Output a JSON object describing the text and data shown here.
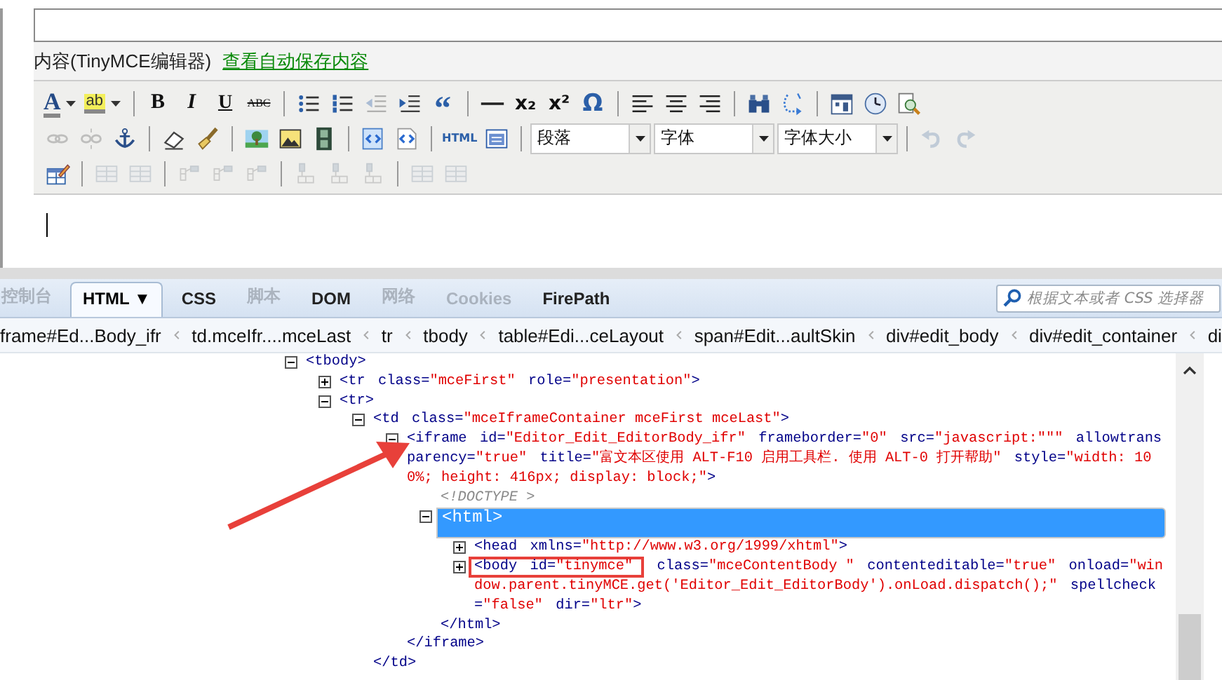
{
  "editor": {
    "label": "内容(TinyMCE编辑器)",
    "autosave_link": "查看自动保存内容",
    "toolbar": {
      "rows": [
        {
          "items": [
            {
              "kind": "fontcolor",
              "glyph": "A",
              "disabled": false
            },
            {
              "kind": "highlight",
              "glyph": "ab",
              "disabled": false
            },
            {
              "kind": "sep"
            },
            {
              "kind": "bold",
              "glyph": "B",
              "disabled": false
            },
            {
              "kind": "italic",
              "glyph": "I",
              "disabled": false
            },
            {
              "kind": "underline",
              "glyph": "U",
              "disabled": false
            },
            {
              "kind": "strike",
              "glyph": "ABC",
              "disabled": false
            },
            {
              "kind": "sep"
            },
            {
              "kind": "bullets",
              "disabled": false
            },
            {
              "kind": "numbers",
              "disabled": false
            },
            {
              "kind": "outdent",
              "disabled": true
            },
            {
              "kind": "indent",
              "disabled": false
            },
            {
              "kind": "quote",
              "glyph": "“",
              "disabled": false
            },
            {
              "kind": "sep"
            },
            {
              "kind": "rule",
              "disabled": false
            },
            {
              "kind": "glyph",
              "glyph": "x₂",
              "disabled": false
            },
            {
              "kind": "glyph",
              "glyph": "x²",
              "disabled": false
            },
            {
              "kind": "symbol",
              "glyph": "Ω",
              "disabled": false
            },
            {
              "kind": "sep"
            },
            {
              "kind": "align-left",
              "disabled": false
            },
            {
              "kind": "align-center",
              "disabled": false
            },
            {
              "kind": "align-right",
              "disabled": false
            },
            {
              "kind": "sep"
            },
            {
              "kind": "binoculars",
              "disabled": false
            },
            {
              "kind": "replace",
              "disabled": false
            },
            {
              "kind": "sep"
            },
            {
              "kind": "calendar",
              "disabled": false
            },
            {
              "kind": "clock",
              "disabled": false
            },
            {
              "kind": "preview",
              "disabled": false
            }
          ]
        },
        {
          "items": [
            {
              "kind": "link",
              "disabled": true
            },
            {
              "kind": "unlink",
              "disabled": true
            },
            {
              "kind": "anchor",
              "disabled": false
            },
            {
              "kind": "sep"
            },
            {
              "kind": "eraser",
              "disabled": false
            },
            {
              "kind": "brush",
              "disabled": false
            },
            {
              "kind": "sep"
            },
            {
              "kind": "picture",
              "disabled": false
            },
            {
              "kind": "image",
              "disabled": false
            },
            {
              "kind": "film",
              "disabled": false
            },
            {
              "kind": "sep"
            },
            {
              "kind": "template",
              "disabled": false
            },
            {
              "kind": "code",
              "disabled": false
            },
            {
              "kind": "sep"
            },
            {
              "kind": "small",
              "glyph": "HTML",
              "disabled": false
            },
            {
              "kind": "window",
              "disabled": false
            },
            {
              "kind": "sep"
            },
            {
              "kind": "select",
              "value": "段落"
            },
            {
              "kind": "select",
              "value": "字体"
            },
            {
              "kind": "select",
              "value": "字体大小"
            },
            {
              "kind": "sep"
            },
            {
              "kind": "undo",
              "disabled": true
            },
            {
              "kind": "redo",
              "disabled": true
            }
          ]
        },
        {
          "items": [
            {
              "kind": "pencil-table",
              "disabled": false
            },
            {
              "kind": "sep"
            },
            {
              "kind": "grid",
              "disabled": true
            },
            {
              "kind": "grid",
              "disabled": true
            },
            {
              "kind": "sep"
            },
            {
              "kind": "rowop",
              "disabled": true
            },
            {
              "kind": "rowop",
              "disabled": true
            },
            {
              "kind": "rowop",
              "disabled": true
            },
            {
              "kind": "sep"
            },
            {
              "kind": "colop",
              "disabled": true
            },
            {
              "kind": "colop",
              "disabled": true
            },
            {
              "kind": "colop",
              "disabled": true
            },
            {
              "kind": "sep"
            },
            {
              "kind": "grid",
              "disabled": true
            },
            {
              "kind": "grid",
              "disabled": true
            }
          ]
        }
      ]
    }
  },
  "devtools": {
    "tabs": [
      {
        "label": "控制台",
        "selected": false,
        "disabled": true
      },
      {
        "label": "HTML ▼",
        "selected": true,
        "disabled": false
      },
      {
        "label": "CSS",
        "selected": false,
        "disabled": false
      },
      {
        "label": "脚本",
        "selected": false,
        "disabled": true
      },
      {
        "label": "DOM",
        "selected": false,
        "disabled": false
      },
      {
        "label": "网络",
        "selected": false,
        "disabled": true
      },
      {
        "label": "Cookies",
        "selected": false,
        "disabled": true
      },
      {
        "label": "FirePath",
        "selected": false,
        "disabled": false
      }
    ],
    "search": {
      "placeholder": "根据文本或者 CSS 选择器"
    },
    "breadcrumbs": [
      "frame#Ed...Body_ifr",
      "td.mceIfr....mceLast",
      "tr",
      "tbody",
      "table#Edi...ceLayout",
      "span#Edit...aultSkin",
      "div#edit_body",
      "div#edit_container",
      "di"
    ],
    "tree": [
      {
        "kind": "element",
        "tag": "<tbody",
        "end": ">",
        "expanded": true,
        "selected": false,
        "boxed": false,
        "children": [
          {
            "kind": "element",
            "tag": "<tr",
            "attrs": [
              {
                "name": "class=",
                "value": "\"mceFirst\""
              },
              {
                "name": "role=",
                "value": "\"presentation\""
              }
            ],
            "end": ">",
            "expanded": false,
            "selected": false,
            "boxed": false
          },
          {
            "kind": "element",
            "tag": "<tr",
            "end": ">",
            "expanded": true,
            "selected": false,
            "boxed": false,
            "children": [
              {
                "kind": "element",
                "tag": "<td",
                "attrs": [
                  {
                    "name": "class=",
                    "value": "\"mceIframeContainer mceFirst mceLast\""
                  }
                ],
                "end": ">",
                "expanded": true,
                "selected": false,
                "boxed": false,
                "closing": "</td>",
                "children": [
                  {
                    "kind": "element",
                    "tag": "<iframe",
                    "attrs": [
                      {
                        "name": "id=",
                        "value": "\"Editor_Edit_EditorBody_ifr\""
                      },
                      {
                        "name": "frameborder=",
                        "value": "\"0\""
                      },
                      {
                        "name": "src=",
                        "value": "\"javascript:\"\"\""
                      },
                      {
                        "name": "allowtransparency=",
                        "value": "\"true\""
                      },
                      {
                        "name": "title=",
                        "value": "\"富文本区使用 ALT-F10 启用工具栏. 使用 ALT-0 打开帮助\""
                      },
                      {
                        "name": "style=",
                        "value": "\"width: 100%; height: 416px; display: block;\""
                      }
                    ],
                    "end": ">",
                    "expanded": true,
                    "selected": false,
                    "boxed": false,
                    "closing": "</iframe>",
                    "children": [
                      {
                        "kind": "doctype",
                        "text": "<!DOCTYPE >"
                      },
                      {
                        "kind": "element",
                        "tag": "<html",
                        "end": ">",
                        "expanded": true,
                        "selected": true,
                        "boxed": false,
                        "closing": "</html>",
                        "children": [
                          {
                            "kind": "element",
                            "tag": "<head",
                            "attrs": [
                              {
                                "name": "xmlns=",
                                "value": "\"http://www.w3.org/1999/xhtml\""
                              }
                            ],
                            "end": ">",
                            "expanded": false,
                            "selected": false,
                            "boxed": false
                          },
                          {
                            "kind": "element",
                            "tag": "<body",
                            "attrs": [
                              {
                                "name": "id=",
                                "value": "\"tinymce\""
                              },
                              {
                                "name": "class=",
                                "value": "\"mceContentBody \""
                              },
                              {
                                "name": "contenteditable=",
                                "value": "\"true\""
                              },
                              {
                                "name": "onload=",
                                "value": "\"window.parent.tinyMCE.get('Editor_Edit_EditorBody').onLoad.dispatch();\""
                              },
                              {
                                "name": "spellcheck=",
                                "value": "\"false\""
                              },
                              {
                                "name": "dir=",
                                "value": "\"ltr\""
                              }
                            ],
                            "end": ">",
                            "expanded": false,
                            "selected": false,
                            "boxed": true
                          }
                        ]
                      }
                    ]
                  }
                ]
              }
            ]
          }
        ]
      }
    ]
  }
}
